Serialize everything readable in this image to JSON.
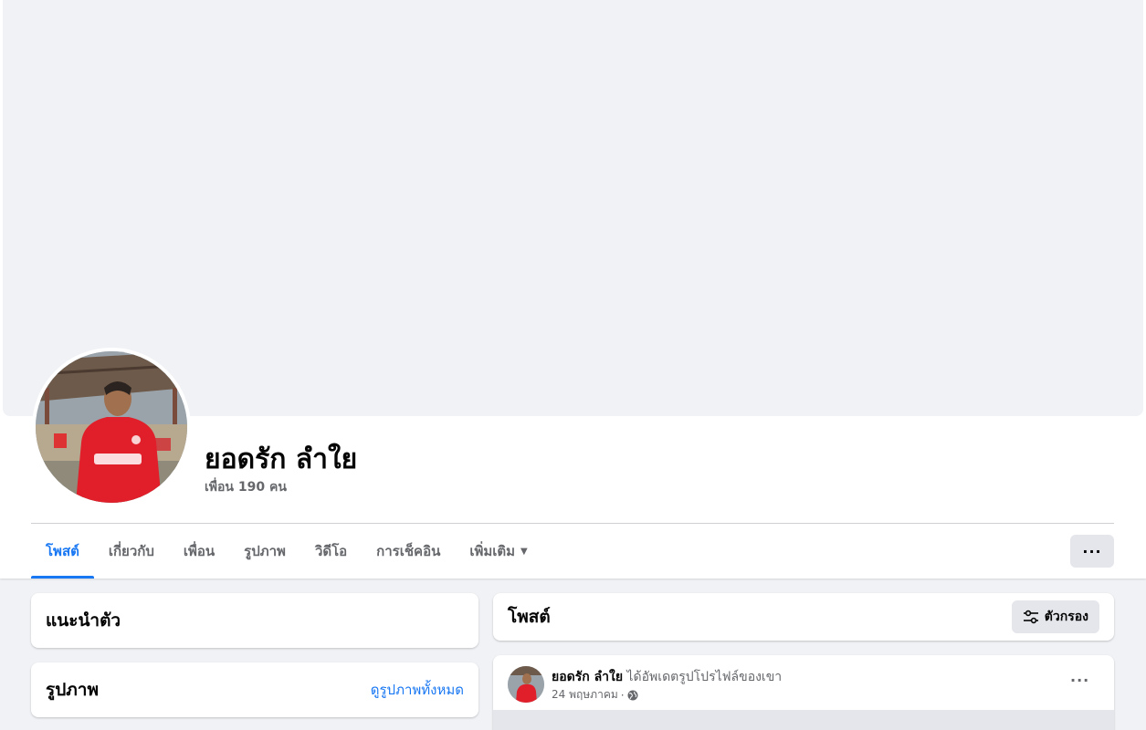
{
  "profile": {
    "name": "ยอดรัก ลำใย",
    "friends": "เพื่อน 190 คน"
  },
  "tabs": [
    {
      "label": "โพสต์",
      "active": true
    },
    {
      "label": "เกี่ยวกับ"
    },
    {
      "label": "เพื่อน"
    },
    {
      "label": "รูปภาพ"
    },
    {
      "label": "วิดีโอ"
    },
    {
      "label": "การเช็คอิน"
    },
    {
      "label": "เพิ่มเติม"
    }
  ],
  "more_button": "···",
  "intro": {
    "title": "แนะนำตัว"
  },
  "photos": {
    "title": "รูปภาพ",
    "see_all": "ดูรูปภาพทั้งหมด"
  },
  "posts": {
    "title": "โพสต์",
    "filter_label": "ตัวกรอง"
  },
  "post": {
    "author": "ยอดรัก ลำใย",
    "action": "ได้อัพเดตรูปโปรไฟล์ของเขา",
    "date": "24 พฤษภาคม",
    "separator": "·",
    "options": "···"
  },
  "colors": {
    "accent": "#1877f2",
    "background": "#f0f2f5",
    "secondary_text": "#65676b"
  }
}
